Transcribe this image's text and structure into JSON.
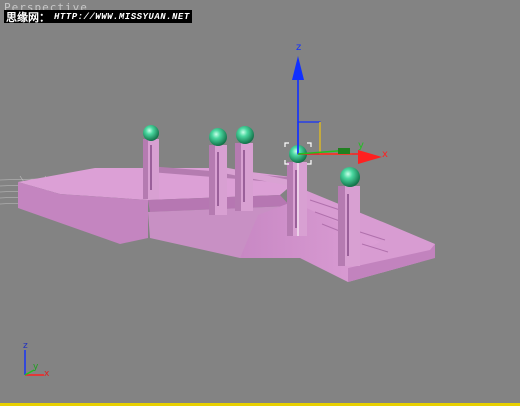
{
  "viewport": {
    "label": "Perspective",
    "active_border_color": "#e8d000",
    "background_color": "#838383"
  },
  "watermark": {
    "chinese_text": "思缘网：",
    "url_text": "HTTP://WWW.MISSYUAN.NET"
  },
  "gizmo": {
    "axis_x": "x",
    "axis_y": "y",
    "axis_z": "z",
    "color_x": "#ff2020",
    "color_y": "#20c020",
    "color_z": "#1030ff"
  },
  "axis_tripod": {
    "axis_x": "x",
    "axis_y": "y",
    "axis_z": "z"
  },
  "scene": {
    "platform_color": "#d49ad0",
    "sphere_color": "#30c890"
  }
}
